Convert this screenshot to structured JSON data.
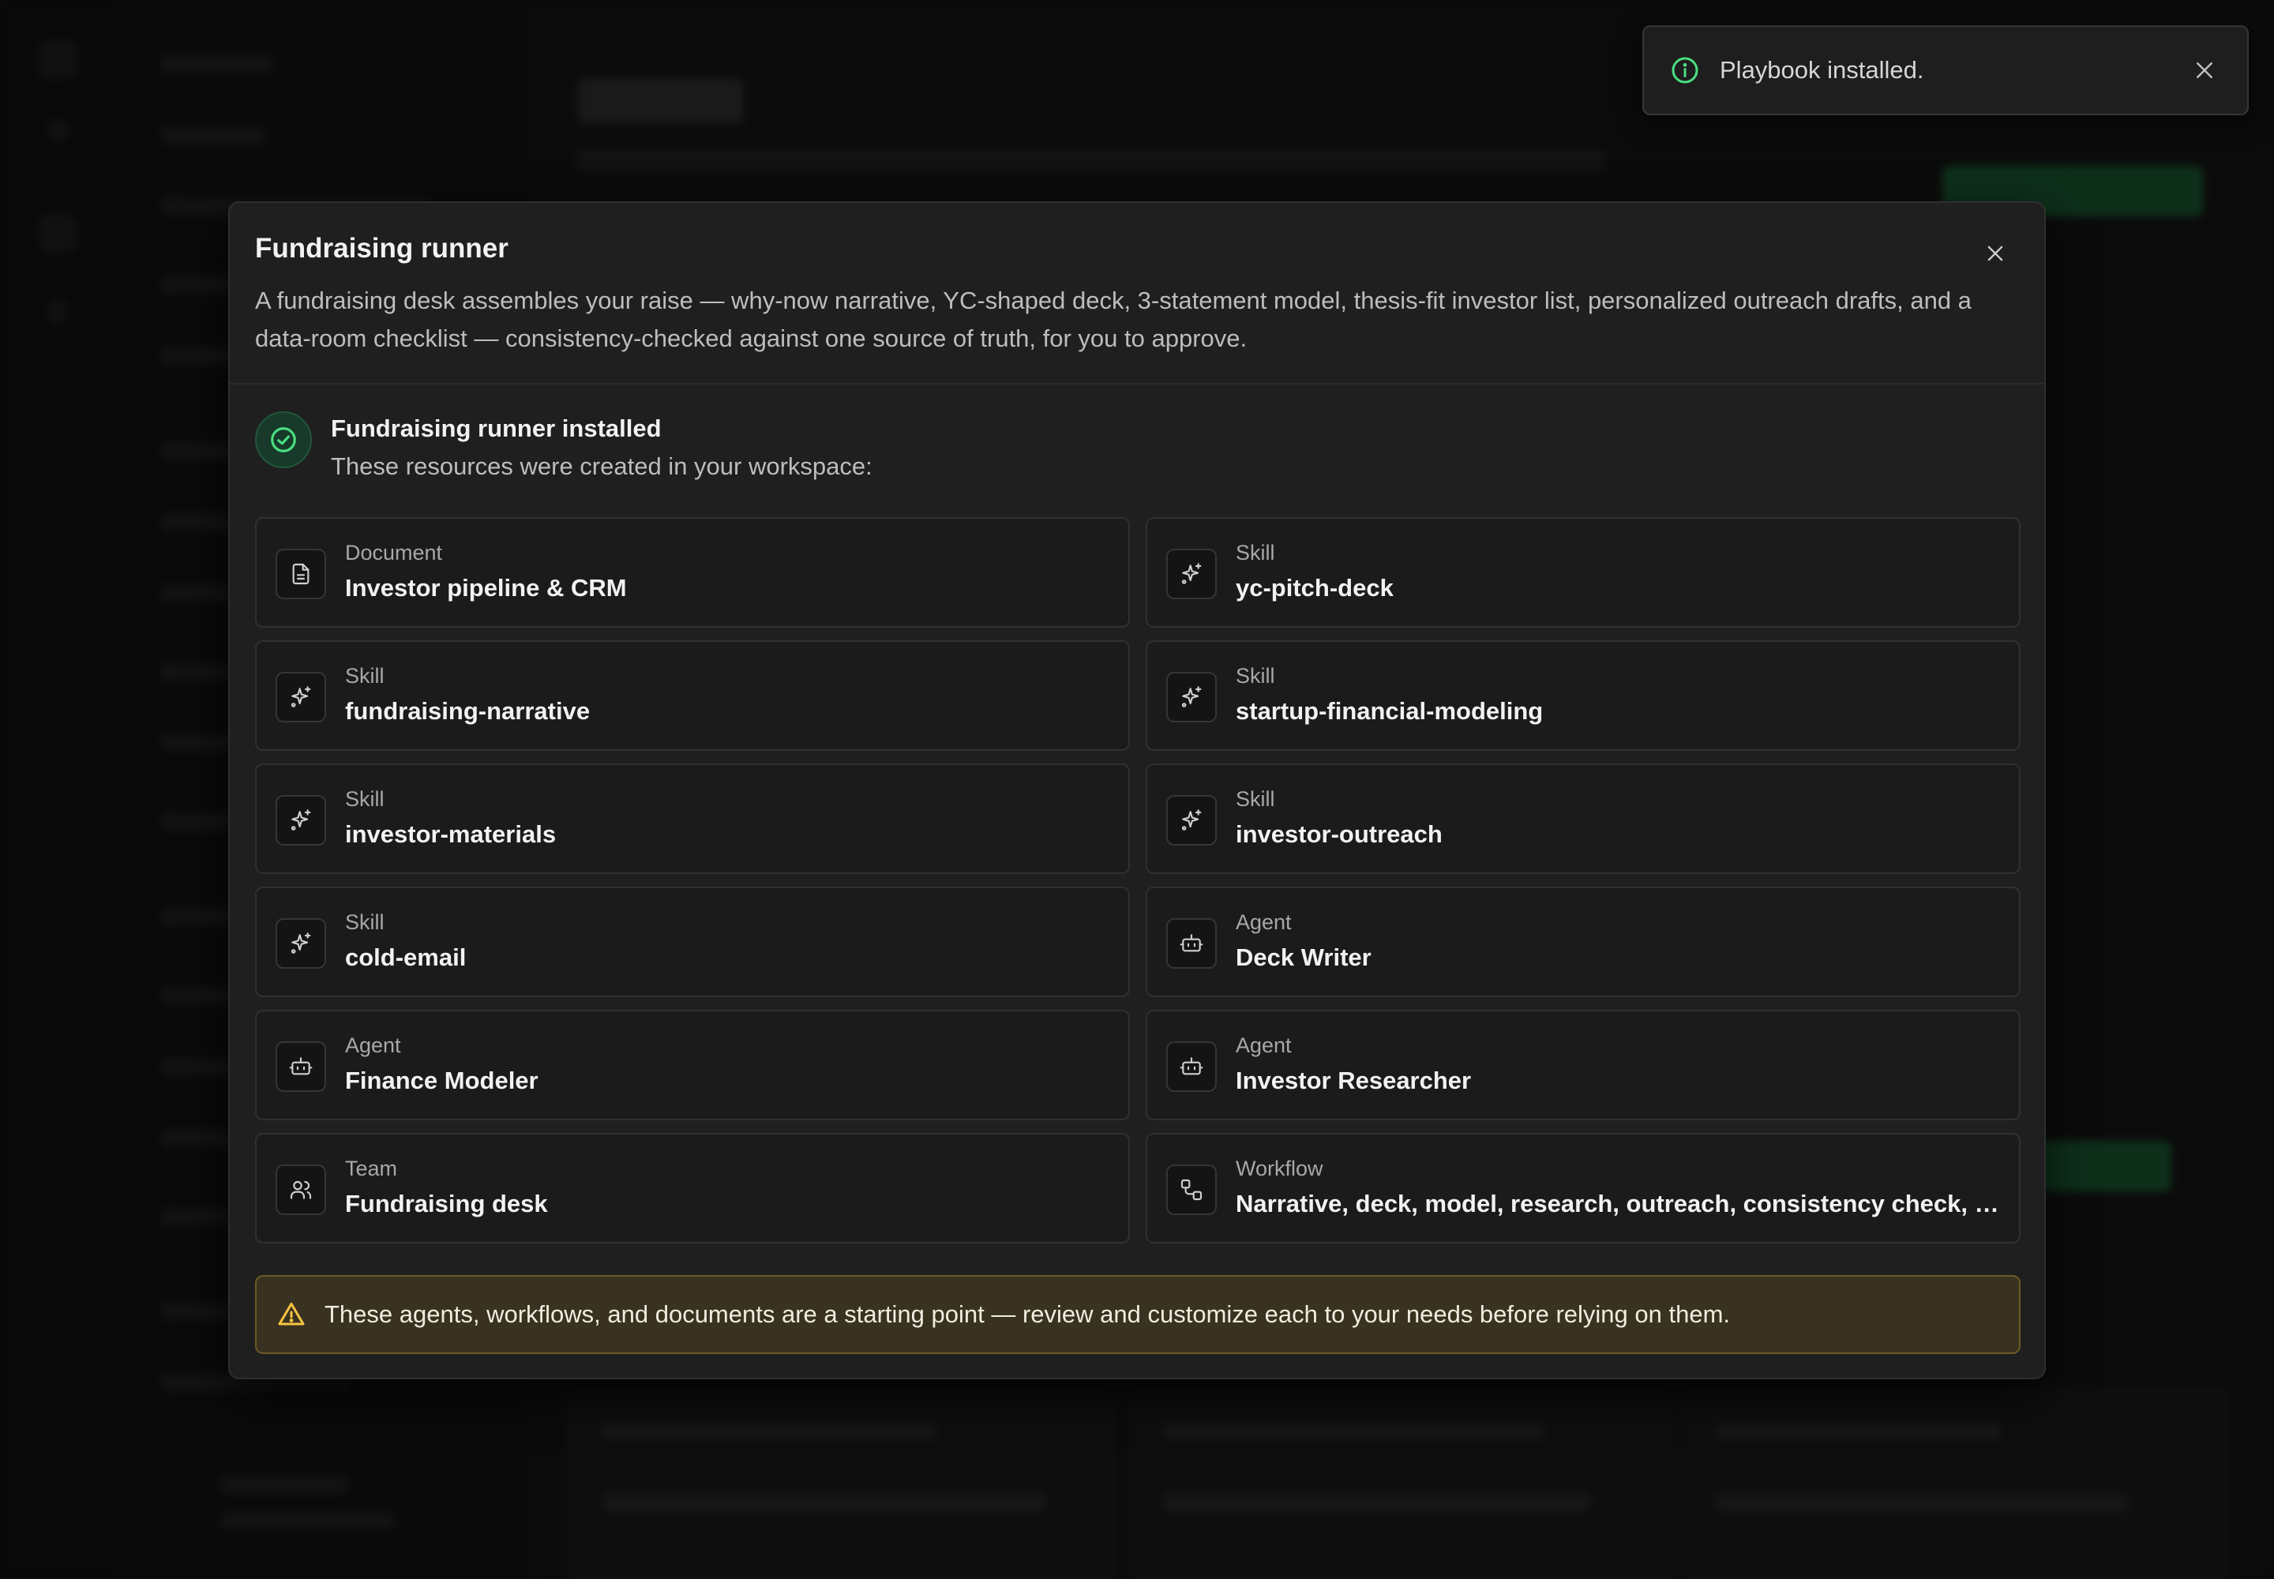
{
  "toast": {
    "message": "Playbook installed.",
    "icon": "info-icon",
    "accent": "#4ade80"
  },
  "modal": {
    "title": "Fundraising runner",
    "description": "A fundraising desk assembles your raise — why-now narrative, YC-shaped deck, 3-statement model, thesis-fit investor list, personalized outreach drafts, and a data-room checklist — consistency-checked against one source of truth, for you to approve.",
    "installed_title": "Fundraising runner installed",
    "installed_subtitle": "These resources were created in your workspace:",
    "resources": [
      {
        "kind": "Document",
        "name": "Investor pipeline & CRM",
        "icon": "document-icon"
      },
      {
        "kind": "Skill",
        "name": "yc-pitch-deck",
        "icon": "sparkle-icon"
      },
      {
        "kind": "Skill",
        "name": "fundraising-narrative",
        "icon": "sparkle-icon"
      },
      {
        "kind": "Skill",
        "name": "startup-financial-modeling",
        "icon": "sparkle-icon"
      },
      {
        "kind": "Skill",
        "name": "investor-materials",
        "icon": "sparkle-icon"
      },
      {
        "kind": "Skill",
        "name": "investor-outreach",
        "icon": "sparkle-icon"
      },
      {
        "kind": "Skill",
        "name": "cold-email",
        "icon": "sparkle-icon"
      },
      {
        "kind": "Agent",
        "name": "Deck Writer",
        "icon": "bot-icon"
      },
      {
        "kind": "Agent",
        "name": "Finance Modeler",
        "icon": "bot-icon"
      },
      {
        "kind": "Agent",
        "name": "Investor Researcher",
        "icon": "bot-icon"
      },
      {
        "kind": "Team",
        "name": "Fundraising desk",
        "icon": "users-icon"
      },
      {
        "kind": "Workflow",
        "name": "Narrative, deck, model, research, outreach, consistency check, ap...",
        "icon": "workflow-icon"
      }
    ],
    "warning": "These agents, workflows, and documents are a starting point — review and customize each to your needs before relying on them."
  },
  "colors": {
    "success": "#4ade80",
    "warning_border": "#6b5a25",
    "warning_bg": "#3a3220",
    "warning_icon": "#f5c542"
  }
}
